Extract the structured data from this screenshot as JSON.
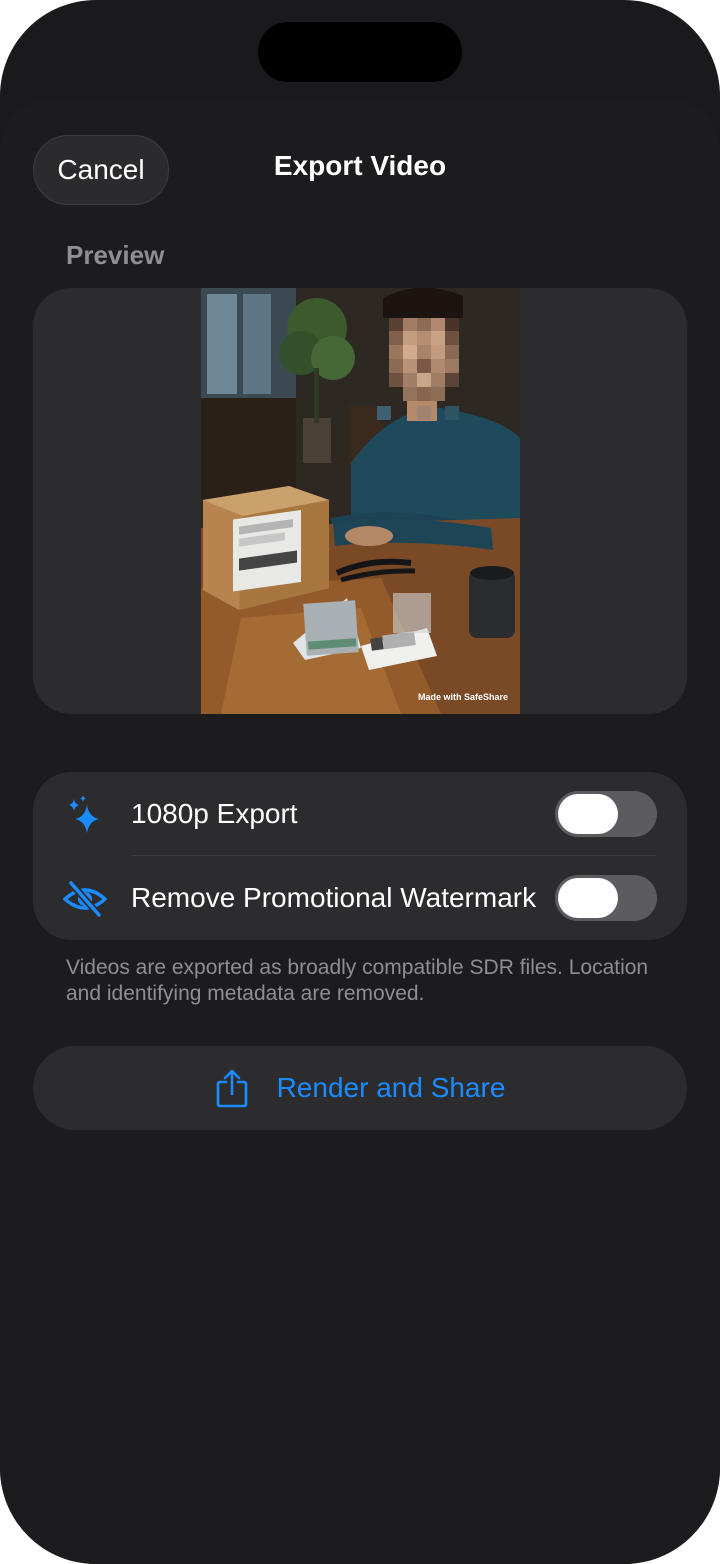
{
  "header": {
    "cancel_label": "Cancel",
    "title": "Export Video"
  },
  "preview": {
    "section_label": "Preview",
    "watermark_text": "Made with SafeShare"
  },
  "options": [
    {
      "label": "1080p Export",
      "icon": "sparkles-icon",
      "enabled": false
    },
    {
      "label": "Remove Promotional Watermark",
      "icon": "eye-slash-icon",
      "enabled": false
    }
  ],
  "footnote": "Videos are exported as broadly compatible SDR files. Location and identifying metadata are removed.",
  "share": {
    "label": "Render and Share",
    "icon": "share-icon"
  },
  "colors": {
    "accent": "#1a8cff",
    "background": "#1c1c1e",
    "card": "#2c2c2e",
    "secondary_text": "#8e8e93"
  }
}
